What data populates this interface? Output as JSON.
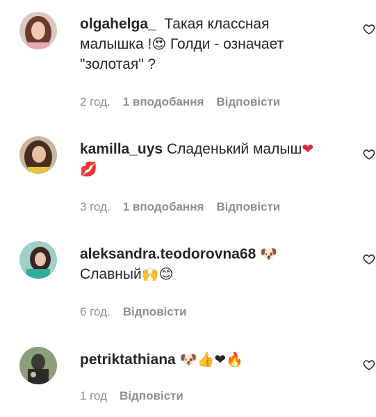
{
  "comments": [
    {
      "username": "olgahelga_",
      "text_1": "Такая классная",
      "text_2": "малышка !",
      "emoji_2": "😍",
      "text_2b": "Голди - означает",
      "text_3": "\"золотая\" ?",
      "time": "2 год.",
      "likes": "1 вподобання",
      "reply": "Відповісти"
    },
    {
      "username": "kamilla_uys",
      "text_1": "Сладенький малыш",
      "emoji_1": "❤",
      "emoji_2": "💋",
      "time": "3 год.",
      "likes": "1 вподобання",
      "reply": "Відповісти"
    },
    {
      "username": "aleksandra.teodorovna68",
      "emoji_1": "🐶",
      "text_2": "Славный",
      "emoji_2": "🙌😊",
      "time": "6 год.",
      "reply": "Відповісти"
    },
    {
      "username": "petriktathiana",
      "emoji_1": "🐶👍❤🔥",
      "time": "1 год",
      "reply": "Відповісти"
    }
  ]
}
